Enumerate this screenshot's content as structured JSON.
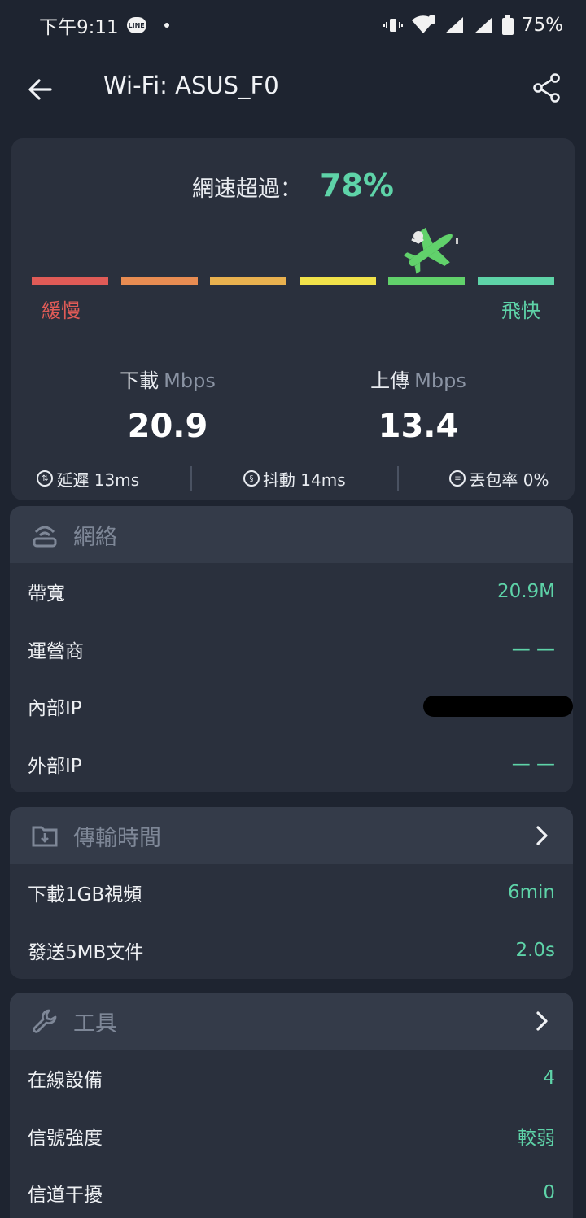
{
  "status_bar": {
    "time": "下午9:11",
    "line_badge": "LINE",
    "battery": "75%",
    "icons": [
      "vibrate-icon",
      "wifi-icon",
      "signal-icon",
      "signal-2r-icon",
      "battery-icon"
    ]
  },
  "app_bar": {
    "title": "Wi-Fi: ASUS_F0"
  },
  "speed": {
    "beat_label": "網速超過：",
    "beat_value": "78%",
    "slow_label": "緩慢",
    "fast_label": "飛快",
    "scale_colors": [
      "#e05b57",
      "#e88c52",
      "#e9b14f",
      "#f1e24a",
      "#61d16b",
      "#5ed3a8"
    ],
    "level_segment": 5,
    "download_label": "下載",
    "upload_label": "上傳",
    "unit": "Mbps",
    "download_value": "20.9",
    "upload_value": "13.4",
    "latency": "延遲 13ms",
    "jitter": "抖動 14ms",
    "loss": "丟包率 0%"
  },
  "network": {
    "title": "網絡",
    "rows": [
      {
        "k": "帶寬",
        "v": "20.9M"
      },
      {
        "k": "運營商",
        "v": "— —"
      },
      {
        "k": "內部IP",
        "v": ""
      },
      {
        "k": "外部IP",
        "v": "— —"
      }
    ]
  },
  "transfer": {
    "title": "傳輸時間",
    "rows": [
      {
        "k": "下載1GB視頻",
        "v": "6min"
      },
      {
        "k": "發送5MB文件",
        "v": "2.0s"
      }
    ]
  },
  "tools": {
    "title": "工具",
    "rows": [
      {
        "k": "在線設備",
        "v": "4"
      },
      {
        "k": "信號強度",
        "v": "較弱"
      },
      {
        "k": "信道干擾",
        "v": "0"
      }
    ]
  },
  "colors": {
    "accent": "#5ed3a8",
    "bg": "#1e2430",
    "card": "#2a303d"
  }
}
